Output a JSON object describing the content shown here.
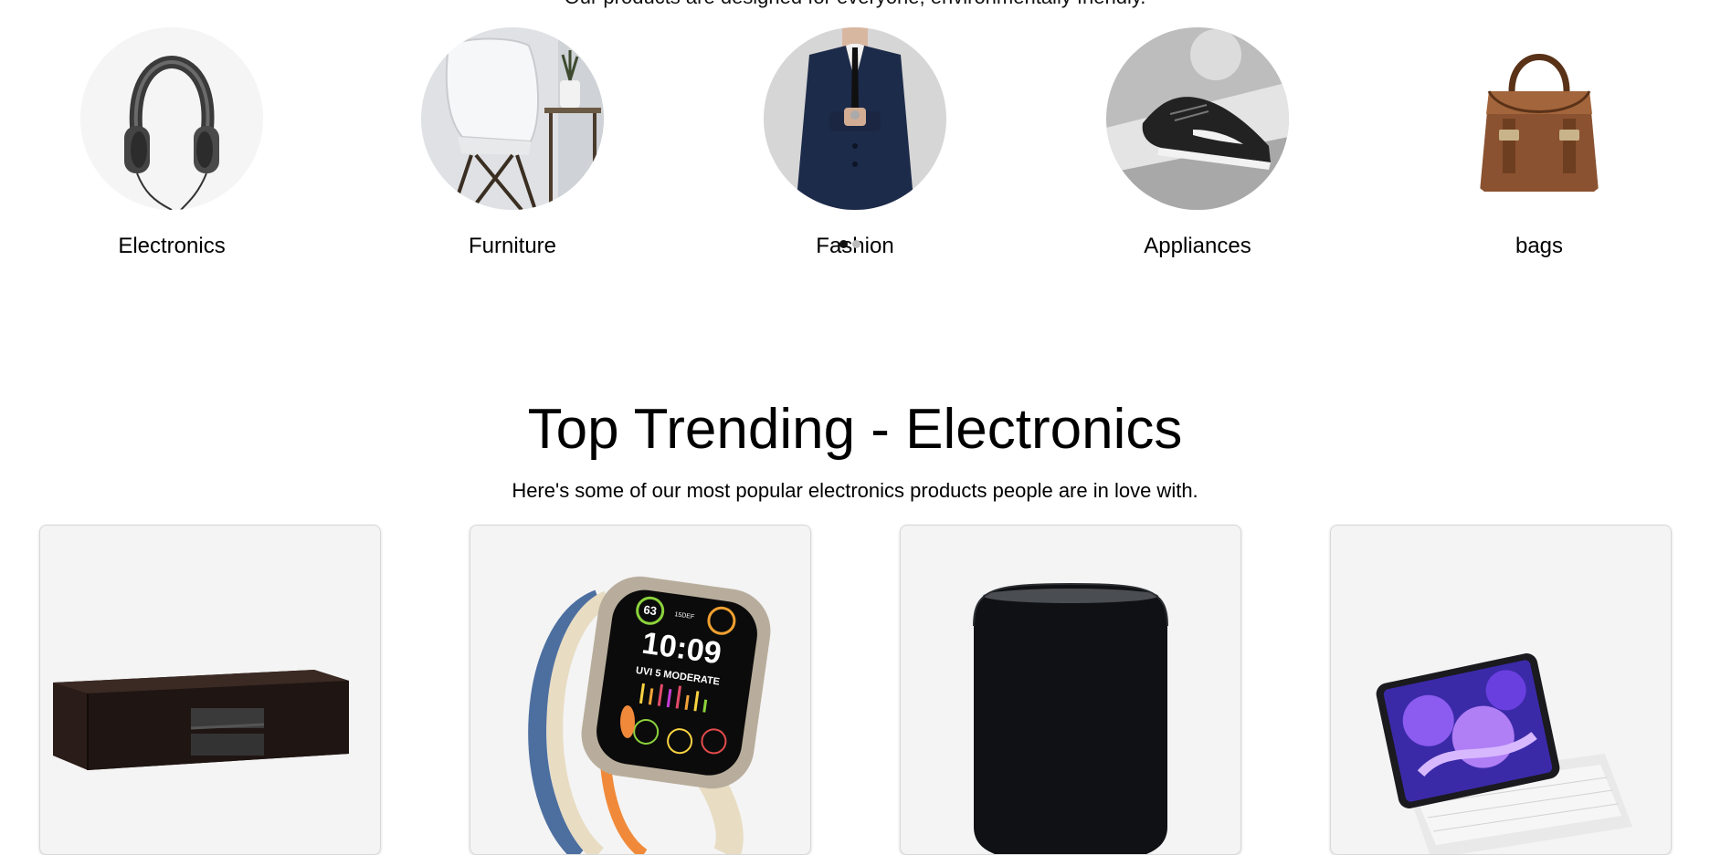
{
  "tagline": "Our products are designed for everyone, environmentally friendly.",
  "categories": [
    {
      "label": "Electronics",
      "icon": "headphones-image"
    },
    {
      "label": "Furniture",
      "icon": "chair-image"
    },
    {
      "label": "Fashion",
      "icon": "suit-image"
    },
    {
      "label": "Appliances",
      "icon": "sneaker-image"
    },
    {
      "label": "bags",
      "icon": "handbag-image"
    }
  ],
  "trending": {
    "title": "Top Trending - Electronics",
    "subtitle": "Here's some of our most popular electronics products people are in love with.",
    "products": [
      {
        "name": "tv-stand",
        "icon": "tv-stand-image"
      },
      {
        "name": "smartwatch",
        "icon": "smartwatch-image",
        "watch_time": "10:09",
        "watch_status": "UVI 5 MODERATE",
        "watch_top_left": "63",
        "watch_top_right": "15DEF"
      },
      {
        "name": "smart-speaker",
        "icon": "speaker-image"
      },
      {
        "name": "tablet-keyboard",
        "icon": "tablet-image"
      }
    ]
  },
  "colors": {
    "card_bg": "#f4f4f4",
    "card_border": "#d8d8d8",
    "text": "#000000"
  }
}
